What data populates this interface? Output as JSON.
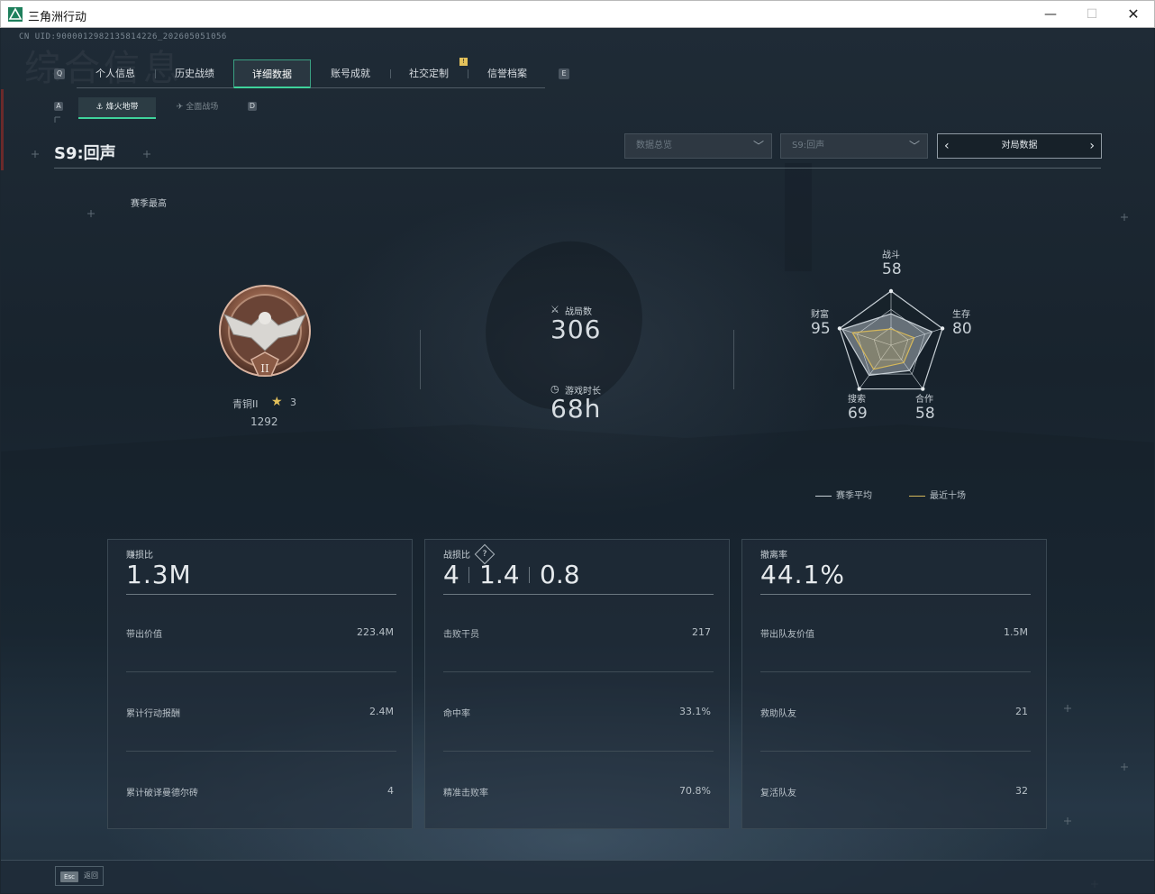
{
  "window": {
    "title": "三角洲行动",
    "min": "—",
    "max": "☐",
    "close": "✕"
  },
  "uid": "CN UID:9000012982135814226_202605051056",
  "ghost_title": "综合信息",
  "tabs": {
    "left_key": "Q",
    "right_key": "E",
    "items": [
      {
        "label": "个人信息"
      },
      {
        "label": "历史战绩"
      },
      {
        "label": "详细数据"
      },
      {
        "label": "账号成就"
      },
      {
        "label": "社交定制"
      },
      {
        "label": "信誉档案"
      }
    ],
    "badge": "!"
  },
  "subtabs": {
    "left_key": "A",
    "right_key": "D",
    "active": "烽火地带",
    "inactive": "全面战场"
  },
  "season_title": "S9:回声",
  "filters": {
    "data_overview": "数据总览",
    "season": "S9:回声",
    "match_data": "对局数据"
  },
  "season_best": "赛季最高",
  "rank": {
    "name": "青铜II",
    "stars": "3",
    "score": "1292",
    "tier_numeral": "II"
  },
  "summary": {
    "matches_label": "战局数",
    "matches": "306",
    "playtime_label": "游戏时长",
    "playtime": "68h"
  },
  "radar": {
    "axes": [
      {
        "label": "战斗",
        "value": "58"
      },
      {
        "label": "生存",
        "value": "80"
      },
      {
        "label": "合作",
        "value": "58"
      },
      {
        "label": "搜索",
        "value": "69"
      },
      {
        "label": "财富",
        "value": "95"
      }
    ],
    "season_avg": [
      58,
      80,
      58,
      69,
      95
    ],
    "recent_ten": [
      30,
      45,
      40,
      55,
      75
    ],
    "legend_avg": "赛季平均",
    "legend_recent": "最近十场",
    "color_avg": "#c8d0d6",
    "color_recent": "#d6b85a"
  },
  "cards": [
    {
      "label": "赚损比",
      "value": "1.3M",
      "rows": [
        {
          "label": "带出价值",
          "value": "223.4M"
        },
        {
          "label": "累计行动报酬",
          "value": "2.4M"
        },
        {
          "label": "累计破译曼德尔砖",
          "value": "4"
        }
      ]
    },
    {
      "label": "战损比",
      "help": "?",
      "segments": [
        "4",
        "1.4",
        "0.8"
      ],
      "rows": [
        {
          "label": "击败干员",
          "value": "217"
        },
        {
          "label": "命中率",
          "value": "33.1%"
        },
        {
          "label": "精准击败率",
          "value": "70.8%"
        }
      ]
    },
    {
      "label": "撤离率",
      "value": "44.1%",
      "rows": [
        {
          "label": "带出队友价值",
          "value": "1.5M"
        },
        {
          "label": "救助队友",
          "value": "21"
        },
        {
          "label": "复活队友",
          "value": "32"
        }
      ]
    }
  ],
  "bottom": {
    "esc": "Esc",
    "back": "返回"
  }
}
